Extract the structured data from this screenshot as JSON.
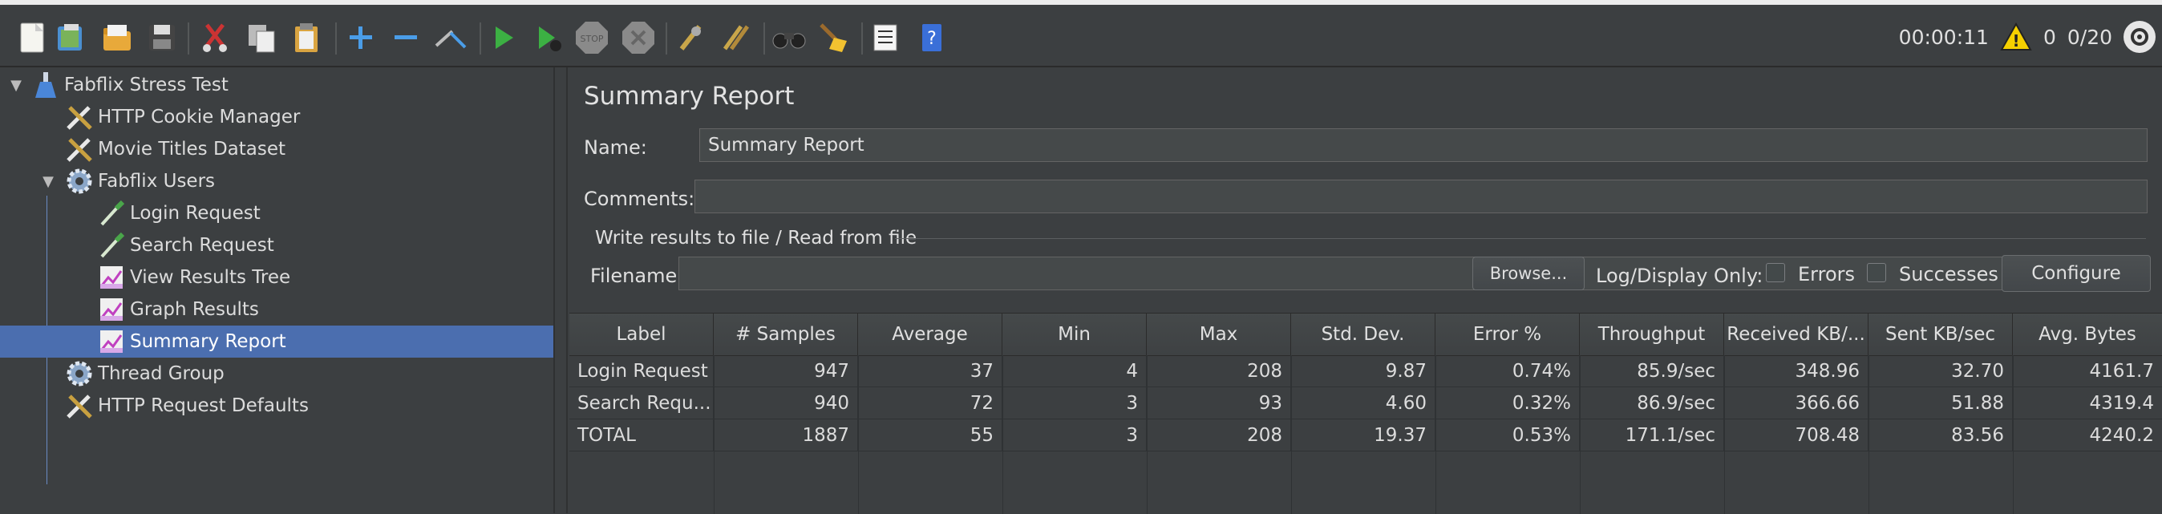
{
  "toolbar": {
    "timer": "00:00:11",
    "warnings": "0",
    "threads": "0/20",
    "icons": [
      "new-icon",
      "templates-icon",
      "open-icon",
      "save-icon",
      "cut-icon",
      "copy-icon",
      "paste-icon",
      "expand-icon",
      "collapse-icon",
      "toggle-icon",
      "start-icon",
      "start-no-pause-icon",
      "stop-icon",
      "shutdown-icon",
      "clear-icon",
      "clear-all-icon",
      "search-icon",
      "reset-search-icon",
      "function-helper-icon",
      "help-icon"
    ]
  },
  "tree": {
    "items": [
      {
        "label": "Fabflix Stress Test",
        "icon": "test-plan-icon"
      },
      {
        "label": "HTTP Cookie Manager",
        "icon": "config-tools-icon"
      },
      {
        "label": "Movie Titles Dataset",
        "icon": "config-tools-icon"
      },
      {
        "label": "Fabflix Users",
        "icon": "thread-group-gear-icon"
      },
      {
        "label": "Login Request",
        "icon": "sampler-pipette-icon"
      },
      {
        "label": "Search Request",
        "icon": "sampler-pipette-icon"
      },
      {
        "label": "View Results Tree",
        "icon": "listener-chart-icon"
      },
      {
        "label": "Graph Results",
        "icon": "listener-chart-icon"
      },
      {
        "label": "Summary Report",
        "icon": "listener-chart-icon"
      },
      {
        "label": "Thread Group",
        "icon": "thread-group-gear-icon"
      },
      {
        "label": "HTTP Request Defaults",
        "icon": "config-tools-icon"
      }
    ]
  },
  "panel": {
    "title": "Summary Report",
    "name_label": "Name:",
    "name_value": "Summary Report",
    "comments_label": "Comments:",
    "comments_value": "",
    "file_group_title": "Write results to file / Read from file",
    "filename_label": "Filename",
    "filename_value": "",
    "browse_label": "Browse...",
    "log_display_label": "Log/Display Only:",
    "errors_label": "Errors",
    "successes_label": "Successes",
    "configure_label": "Configure"
  },
  "table": {
    "headers": [
      "Label",
      "# Samples",
      "Average",
      "Min",
      "Max",
      "Std. Dev.",
      "Error %",
      "Throughput",
      "Received KB/...",
      "Sent KB/sec",
      "Avg. Bytes"
    ],
    "rows": [
      [
        "Login Request",
        "947",
        "37",
        "4",
        "208",
        "9.87",
        "0.74%",
        "85.9/sec",
        "348.96",
        "32.70",
        "4161.7"
      ],
      [
        "Search Requ...",
        "940",
        "72",
        "3",
        "93",
        "4.60",
        "0.32%",
        "86.9/sec",
        "366.66",
        "51.88",
        "4319.4"
      ],
      [
        "TOTAL",
        "1887",
        "55",
        "3",
        "208",
        "19.37",
        "0.53%",
        "171.1/sec",
        "708.48",
        "83.56",
        "4240.2"
      ]
    ]
  }
}
